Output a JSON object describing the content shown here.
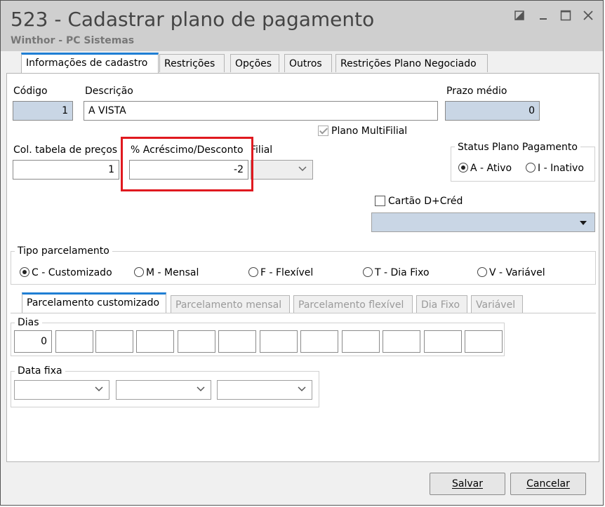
{
  "window": {
    "title": "523 - Cadastrar plano de pagamento",
    "subtitle": "Winthor - PC Sistemas"
  },
  "tabs": [
    {
      "label": "Informações de cadastro",
      "active": true
    },
    {
      "label": "Restrições",
      "active": false
    },
    {
      "label": "Opções",
      "active": false
    },
    {
      "label": "Outros",
      "active": false
    },
    {
      "label": "Restrições Plano Negociado",
      "active": false
    }
  ],
  "form": {
    "codigo_label": "Código",
    "codigo_value": "1",
    "descricao_label": "Descrição",
    "descricao_value": "A VISTA",
    "prazo_label": "Prazo médio",
    "prazo_value": "0",
    "multifilial_label": "Plano MultiFilial",
    "col_tabela_label": "Col. tabela de preços",
    "col_tabela_value": "1",
    "acrescimo_label": "% Acréscimo/Desconto",
    "acrescimo_value": "-2",
    "filial_label": "Filial",
    "filial_value": "",
    "status_label": "Status Plano Pagamento",
    "status_ativo": "A - Ativo",
    "status_inativo": "I - Inativo",
    "cartao_label": "Cartão D+Créd"
  },
  "tipo_parcelamento": {
    "label": "Tipo parcelamento",
    "options": [
      "C - Customizado",
      "M - Mensal",
      "F - Flexível",
      "T - Dia Fixo",
      "V - Variável"
    ],
    "selected": "C - Customizado"
  },
  "subtabs": [
    {
      "label": "Parcelamento customizado",
      "enabled": true
    },
    {
      "label": "Parcelamento mensal",
      "enabled": false
    },
    {
      "label": "Parcelamento flexível",
      "enabled": false
    },
    {
      "label": "Dia Fixo",
      "enabled": false
    },
    {
      "label": "Variável",
      "enabled": false
    }
  ],
  "dias": {
    "label": "Dias",
    "values": [
      "0",
      "",
      "",
      "",
      "",
      "",
      "",
      "",
      "",
      "",
      "",
      ""
    ]
  },
  "data_fixa": {
    "label": "Data fixa"
  },
  "buttons": {
    "save": "Salvar",
    "cancel": "Cancelar"
  },
  "colors": {
    "highlight": "#e0191f",
    "tab_accent": "#1f7fd4",
    "readonly_field": "#c9d6e5"
  }
}
